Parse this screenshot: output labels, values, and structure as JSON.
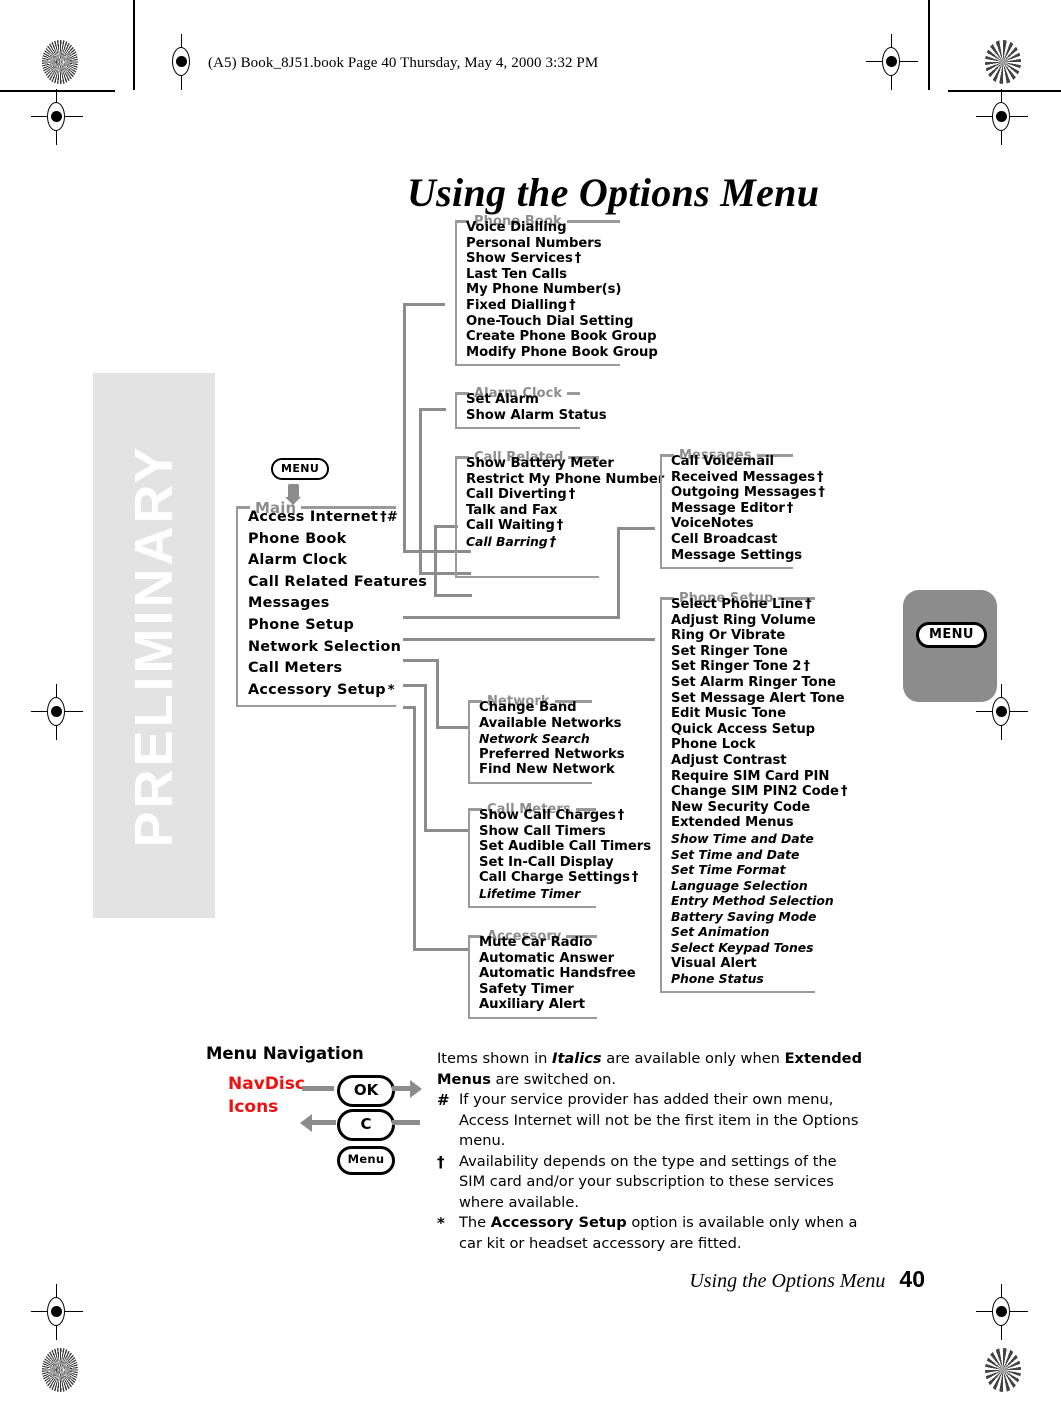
{
  "page": {
    "book_header": "(A5) Book_8J51.book  Page 40  Thursday, May 4, 2000  3:32 PM",
    "title": "Using the Options Menu",
    "watermark": "PRELIMINARY",
    "footer_title": "Using the Options Menu",
    "footer_page": "40",
    "side_tab_label": "MENU",
    "menu_button_label": "MENU"
  },
  "main_menu": {
    "caption": "Main",
    "items": [
      {
        "label": "Access Internet",
        "marks": "†#",
        "italic": false
      },
      {
        "label": "Phone Book",
        "marks": "",
        "italic": false
      },
      {
        "label": "Alarm Clock",
        "marks": "",
        "italic": false
      },
      {
        "label": "Call Related Features",
        "marks": "",
        "italic": false
      },
      {
        "label": "Messages",
        "marks": "",
        "italic": false
      },
      {
        "label": "Phone  Setup",
        "marks": "",
        "italic": false
      },
      {
        "label": "Network Selection",
        "marks": "",
        "italic": false
      },
      {
        "label": "Call Meters",
        "marks": "",
        "italic": false
      },
      {
        "label": "Accessory  Setup",
        "marks": "*",
        "italic": false
      }
    ]
  },
  "submenus": {
    "phone_book": {
      "caption": "Phone Book",
      "items": [
        {
          "label": "Voice Dialling",
          "marks": "",
          "italic": false
        },
        {
          "label": "Personal Numbers",
          "marks": "",
          "italic": false
        },
        {
          "label": "Show Services",
          "marks": "†",
          "italic": false
        },
        {
          "label": "Last Ten Calls",
          "marks": "",
          "italic": false
        },
        {
          "label": "My Phone Number(s)",
          "marks": "",
          "italic": false
        },
        {
          "label": "Fixed Dialling",
          "marks": "†",
          "italic": false
        },
        {
          "label": "One-Touch Dial Setting",
          "marks": "",
          "italic": false
        },
        {
          "label": "Create Phone Book Group",
          "marks": "",
          "italic": false
        },
        {
          "label": "Modify Phone Book Group",
          "marks": "",
          "italic": false
        }
      ]
    },
    "alarm_clock": {
      "caption": "Alarm Clock",
      "items": [
        {
          "label": "Set Alarm",
          "marks": "",
          "italic": false
        },
        {
          "label": "Show Alarm Status",
          "marks": "",
          "italic": false
        }
      ]
    },
    "call_related": {
      "caption": "Call Related",
      "items": [
        {
          "label": "Show Battery Meter",
          "marks": "",
          "italic": false
        },
        {
          "label": "Restrict My Phone Number",
          "marks": "",
          "italic": false
        },
        {
          "label": "Call Diverting",
          "marks": "†",
          "italic": false
        },
        {
          "label": "Talk and Fax",
          "marks": "",
          "italic": false
        },
        {
          "label": "Call Waiting",
          "marks": "†",
          "italic": false
        },
        {
          "label": "Call Barring",
          "marks": "†",
          "italic": true
        }
      ]
    },
    "messages": {
      "caption": "Messages",
      "items": [
        {
          "label": "Call Voicemail",
          "marks": "",
          "italic": false
        },
        {
          "label": "Received Messages",
          "marks": "†",
          "italic": false
        },
        {
          "label": "Outgoing Messages",
          "marks": "†",
          "italic": false
        },
        {
          "label": "Message Editor",
          "marks": "†",
          "italic": false
        },
        {
          "label": "VoiceNotes",
          "marks": "",
          "italic": false
        },
        {
          "label": "Cell Broadcast",
          "marks": "",
          "italic": false
        },
        {
          "label": "Message Settings",
          "marks": "",
          "italic": false
        }
      ]
    },
    "phone_setup": {
      "caption": "Phone Setup",
      "items": [
        {
          "label": "Select Phone Line",
          "marks": "†",
          "italic": false
        },
        {
          "label": "Adjust Ring Volume",
          "marks": "",
          "italic": false
        },
        {
          "label": "Ring Or Vibrate",
          "marks": "",
          "italic": false
        },
        {
          "label": "Set Ringer Tone",
          "marks": "",
          "italic": false
        },
        {
          "label": "Set Ringer Tone 2",
          "marks": "†",
          "italic": false
        },
        {
          "label": "Set Alarm Ringer Tone",
          "marks": "",
          "italic": false
        },
        {
          "label": "Set Message Alert Tone",
          "marks": "",
          "italic": false
        },
        {
          "label": "Edit Music Tone",
          "marks": "",
          "italic": false
        },
        {
          "label": "Quick Access Setup",
          "marks": "",
          "italic": false
        },
        {
          "label": "Phone Lock",
          "marks": "",
          "italic": false
        },
        {
          "label": "Adjust Contrast",
          "marks": "",
          "italic": false
        },
        {
          "label": "Require SIM Card PIN",
          "marks": "",
          "italic": false
        },
        {
          "label": "Change SIM PIN2 Code",
          "marks": "†",
          "italic": false
        },
        {
          "label": "New Security Code",
          "marks": "",
          "italic": false
        },
        {
          "label": "Extended Menus",
          "marks": "",
          "italic": false
        },
        {
          "label": "Show Time and Date",
          "marks": "",
          "italic": true
        },
        {
          "label": "Set Time and Date",
          "marks": "",
          "italic": true
        },
        {
          "label": "Set Time Format",
          "marks": "",
          "italic": true
        },
        {
          "label": "Language Selection",
          "marks": "",
          "italic": true
        },
        {
          "label": "Entry Method Selection",
          "marks": "",
          "italic": true
        },
        {
          "label": "Battery Saving Mode",
          "marks": "",
          "italic": true
        },
        {
          "label": "Set  Animation",
          "marks": "",
          "italic": true
        },
        {
          "label": "Select Keypad Tones",
          "marks": "",
          "italic": true
        },
        {
          "label": "Visual Alert",
          "marks": "",
          "italic": false
        },
        {
          "label": "Phone Status",
          "marks": "",
          "italic": true
        }
      ]
    },
    "network": {
      "caption": "Network",
      "items": [
        {
          "label": "Change Band",
          "marks": "",
          "italic": false
        },
        {
          "label": "Available Networks",
          "marks": "",
          "italic": false
        },
        {
          "label": "Network Search",
          "marks": "",
          "italic": true
        },
        {
          "label": "Preferred Networks",
          "marks": "",
          "italic": false
        },
        {
          "label": "Find New Network",
          "marks": "",
          "italic": false
        }
      ]
    },
    "call_meters": {
      "caption": "Call Meters",
      "items": [
        {
          "label": "Show Call Charges",
          "marks": "†",
          "italic": false
        },
        {
          "label": "Show Call Timers",
          "marks": "",
          "italic": false
        },
        {
          "label": "Set Audible Call Timers",
          "marks": "",
          "italic": false
        },
        {
          "label": "Set In-Call Display",
          "marks": "",
          "italic": false
        },
        {
          "label": "Call Charge Settings",
          "marks": "†",
          "italic": false
        },
        {
          "label": "Lifetime Timer",
          "marks": "",
          "italic": true
        }
      ]
    },
    "accessory": {
      "caption": "Accessory",
      "items": [
        {
          "label": "Mute Car Radio",
          "marks": "",
          "italic": false
        },
        {
          "label": "Automatic Answer",
          "marks": "",
          "italic": false
        },
        {
          "label": "Automatic Handsfree",
          "marks": "",
          "italic": false
        },
        {
          "label": "Safety Timer",
          "marks": "",
          "italic": false
        },
        {
          "label": "Auxiliary Alert",
          "marks": "",
          "italic": false
        }
      ]
    }
  },
  "legend": {
    "nav_title": "Menu Navigation",
    "navdisc_line1": "NavDisc",
    "navdisc_line2": "Icons",
    "keys": [
      {
        "label": "OK"
      },
      {
        "label": "C"
      },
      {
        "label": "Menu"
      }
    ],
    "notes": [
      {
        "mark": "",
        "parts": [
          {
            "t": "Items shown in ",
            "s": "n"
          },
          {
            "t": "Italics",
            "s": "i"
          },
          {
            "t": " are available only when ",
            "s": "n"
          },
          {
            "t": "Extended Menus",
            "s": "b"
          },
          {
            "t": " are switched on.",
            "s": "n"
          }
        ]
      },
      {
        "mark": "#",
        "parts": [
          {
            "t": "If your service provider has added their own menu, Access Internet  will not be the first item in the Options menu.",
            "s": "n"
          }
        ]
      },
      {
        "mark": "†",
        "parts": [
          {
            "t": "Availability depends on the type and settings of the SIM card and/or your subscription to these services where available.",
            "s": "n"
          }
        ]
      },
      {
        "mark": "*",
        "parts": [
          {
            "t": "The ",
            "s": "n"
          },
          {
            "t": "Accessory Setup",
            "s": "b"
          },
          {
            "t": " option is available only when a car kit or headset accessory are fitted.",
            "s": "n"
          }
        ]
      }
    ]
  },
  "colors": {
    "connector": "#8c8c8c",
    "caption": "#8d8d8d",
    "frame": "#9a9a9a",
    "accent_red": "#ee1111",
    "watermark_bg": "#e3e3e3",
    "tab_gray": "#8c8c8c"
  }
}
